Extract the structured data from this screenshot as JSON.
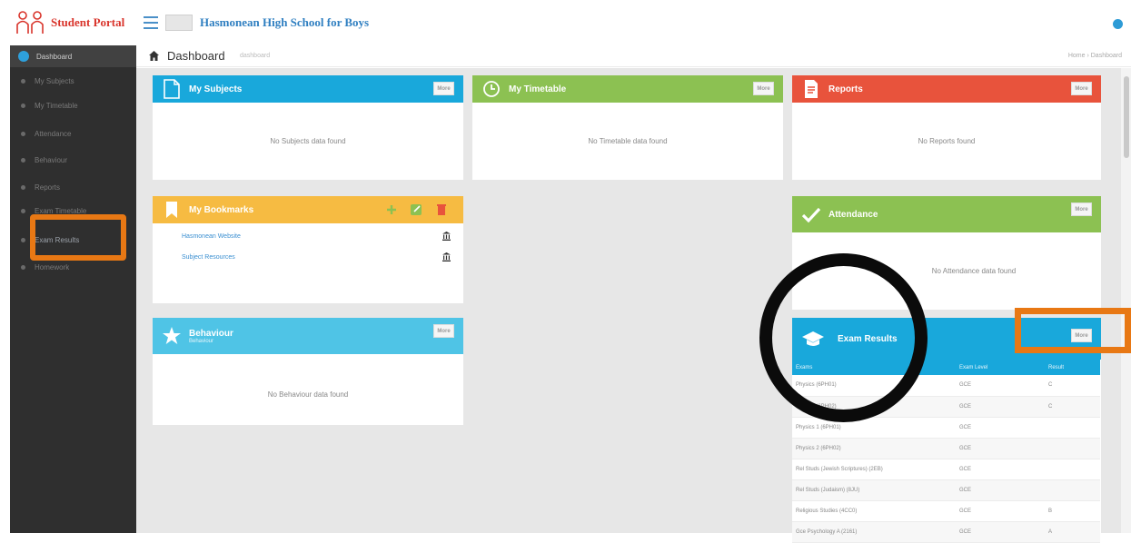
{
  "brand": {
    "name": "Student Portal"
  },
  "school": {
    "name": "Hasmonean High School for Boys"
  },
  "page": {
    "title": "Dashboard",
    "subtitle": "dashboard",
    "breadcrumb": "Home › Dashboard"
  },
  "sidebar": {
    "items": [
      {
        "label": "Dashboard"
      },
      {
        "label": "My Subjects"
      },
      {
        "label": "My Timetable"
      },
      {
        "label": "Attendance"
      },
      {
        "label": "Behaviour"
      },
      {
        "label": "Reports"
      },
      {
        "label": "Exam Timetable"
      },
      {
        "label": "Exam Results"
      },
      {
        "label": "Homework"
      }
    ]
  },
  "panels": {
    "subjects": {
      "title": "My Subjects",
      "more": "More",
      "empty": "No Subjects data found"
    },
    "timetable": {
      "title": "My Timetable",
      "more": "More",
      "empty": "No Timetable data found"
    },
    "reports": {
      "title": "Reports",
      "more": "More",
      "empty": "No Reports found"
    },
    "bookmarks": {
      "title": "My Bookmarks",
      "links": [
        "Hasmonean Website",
        "Subject Resources"
      ]
    },
    "attendance": {
      "title": "Attendance",
      "more": "More",
      "empty": "No Attendance data found"
    },
    "behaviour": {
      "title": "Behaviour",
      "subtitle": "Behaviour",
      "more": "More",
      "empty": "No Behaviour data found"
    },
    "exam_results": {
      "title": "Exam Results",
      "more": "More",
      "columns": [
        "Exams",
        "Exam Level",
        "Result"
      ],
      "rows": [
        [
          "Physics (6PH01)",
          "GCE",
          "C"
        ],
        [
          "Physics (6PH02)",
          "GCE",
          "C"
        ],
        [
          "Physics 1 (6PH01)",
          "GCE",
          ""
        ],
        [
          "Physics 2 (6PH02)",
          "GCE",
          ""
        ],
        [
          "Rel Studs (Jewish Scriptures) (2EB)",
          "GCE",
          ""
        ],
        [
          "Rel Studs (Judaism) (8JU)",
          "GCE",
          ""
        ],
        [
          "Religious Studies (4CC0)",
          "GCE",
          "B"
        ],
        [
          "Gce Psychology A (2161)",
          "GCE",
          "A"
        ]
      ]
    }
  },
  "colors": {
    "subjects": "#19a8db",
    "timetable": "#8cc152",
    "reports": "#e8533c",
    "bookmarks": "#f6bb42",
    "attendance": "#8cc152",
    "behaviour": "#4fc4e6",
    "exam_results": "#19a8db",
    "highlight": "#e87814"
  }
}
